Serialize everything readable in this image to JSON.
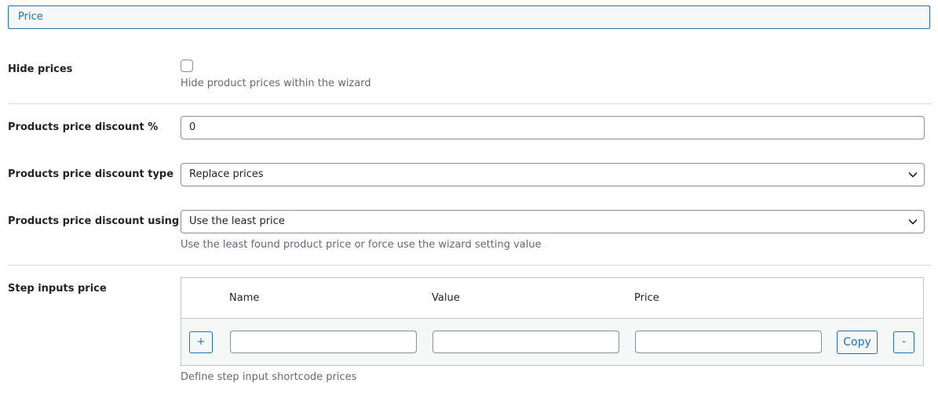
{
  "section": {
    "title": "Price"
  },
  "hide_prices": {
    "label": "Hide prices",
    "checked": false,
    "description": "Hide product prices within the wizard"
  },
  "discount_percent": {
    "label": "Products price discount %",
    "value": "0"
  },
  "discount_type": {
    "label": "Products price discount type",
    "selected": "Replace prices"
  },
  "discount_using": {
    "label": "Products price discount using",
    "selected": "Use the least price",
    "description": "Use the least found product price or force use the wizard setting value"
  },
  "step_inputs": {
    "label": "Step inputs price",
    "columns": [
      "Name",
      "Value",
      "Price"
    ],
    "add_label": "+",
    "copy_label": "Copy",
    "remove_label": "-",
    "row": {
      "name": "",
      "value": "",
      "price": ""
    },
    "description": "Define step input shortcode prices"
  },
  "colors": {
    "accent": "#2271b1",
    "border": "#8c8f94",
    "muted_text": "#646970",
    "divider": "#dcdcde"
  }
}
